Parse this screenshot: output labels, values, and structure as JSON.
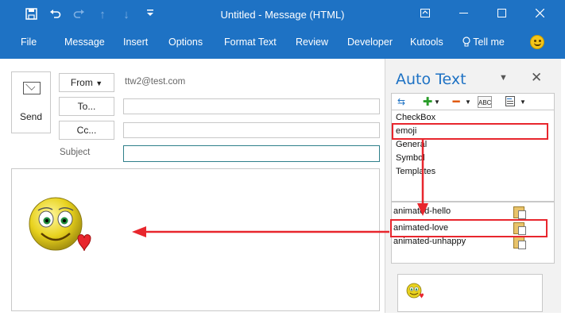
{
  "window": {
    "title": "Untitled  -  Message (HTML)",
    "controls": [
      "restore-ribbon",
      "minimize",
      "maximize",
      "close"
    ]
  },
  "quick_access": [
    "save-icon",
    "undo-icon",
    "redo-icon",
    "up-icon",
    "down-icon",
    "customize-icon"
  ],
  "ribbon": {
    "tabs": [
      "File",
      "Message",
      "Insert",
      "Options",
      "Format Text",
      "Review",
      "Developer",
      "Kutools"
    ],
    "tell_me": "Tell me",
    "accent": "#1e72c4"
  },
  "compose": {
    "send_label": "Send",
    "from_label": "From",
    "from_value": "ttw2@test.com",
    "to_label": "To...",
    "cc_label": "Cc...",
    "subject_label": "Subject",
    "to_value": "",
    "cc_value": "",
    "subject_value": ""
  },
  "autotext": {
    "title": "Auto Text",
    "categories": [
      "CheckBox",
      "emoji",
      "General",
      "Symbol",
      "Templates"
    ],
    "selected_category": "emoji",
    "entries": [
      "animated-hello",
      "animated-love",
      "animated-unhappy"
    ],
    "selected_entry": "animated-love",
    "toolbar_icons": [
      "refresh-icon",
      "add-icon",
      "remove-icon",
      "spellcheck-icon",
      "properties-icon"
    ]
  },
  "annotation_color": "#e8262d"
}
